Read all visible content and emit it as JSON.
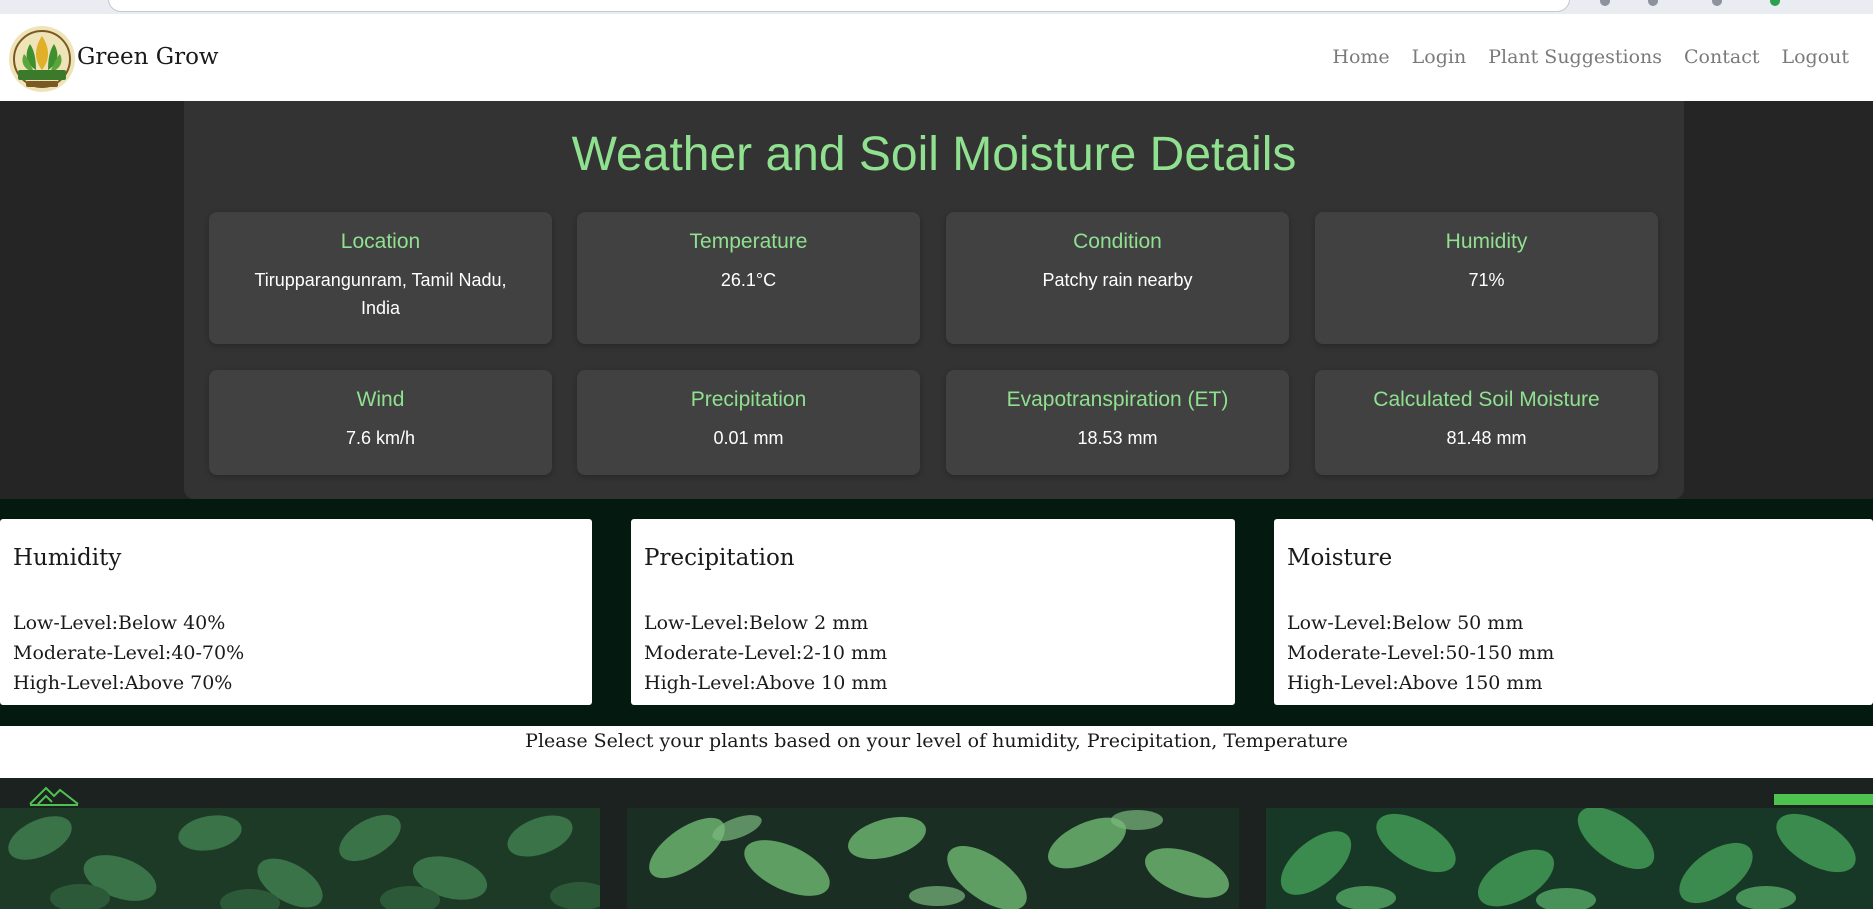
{
  "app": {
    "brand": "Green Grow",
    "logo_icon": "green-grow-logo"
  },
  "nav": {
    "home": "Home",
    "login": "Login",
    "plant_suggestions": "Plant Suggestions",
    "contact": "Contact",
    "logout": "Logout"
  },
  "weather": {
    "title": "Weather and Soil Moisture Details",
    "cards": [
      {
        "label": "Location",
        "value": "Tirupparangunram, Tamil Nadu, India"
      },
      {
        "label": "Temperature",
        "value": "26.1°C"
      },
      {
        "label": "Condition",
        "value": "Patchy rain nearby"
      },
      {
        "label": "Humidity",
        "value": "71%"
      },
      {
        "label": "Wind",
        "value": "7.6 km/h"
      },
      {
        "label": "Precipitation",
        "value": "0.01 mm"
      },
      {
        "label": "Evapotranspiration (ET)",
        "value": "18.53 mm"
      },
      {
        "label": "Calculated Soil Moisture",
        "value": "81.48 mm"
      }
    ]
  },
  "levels": [
    {
      "title": "Humidity",
      "low": "Low-Level:Below 40%",
      "moderate": "Moderate-Level:40-70%",
      "high": "High-Level:Above 70%"
    },
    {
      "title": "Precipitation",
      "low": "Low-Level:Below 2 mm",
      "moderate": "Moderate-Level:2-10 mm",
      "high": "High-Level:Above 10 mm"
    },
    {
      "title": "Moisture",
      "low": "Low-Level:Below 50 mm",
      "moderate": "Moderate-Level:50-150 mm",
      "high": "High-Level:Above 150 mm"
    }
  ],
  "instruction": "Please Select your plants based on your level of humidity, Precipitation, Temperature",
  "colors": {
    "accent_green": "#8fe08f",
    "weather_panel": "#333333",
    "weather_card": "#414141",
    "levels_band": "#041a10",
    "gallery_bg": "#1c221f",
    "bar_green": "#4ec24e"
  }
}
